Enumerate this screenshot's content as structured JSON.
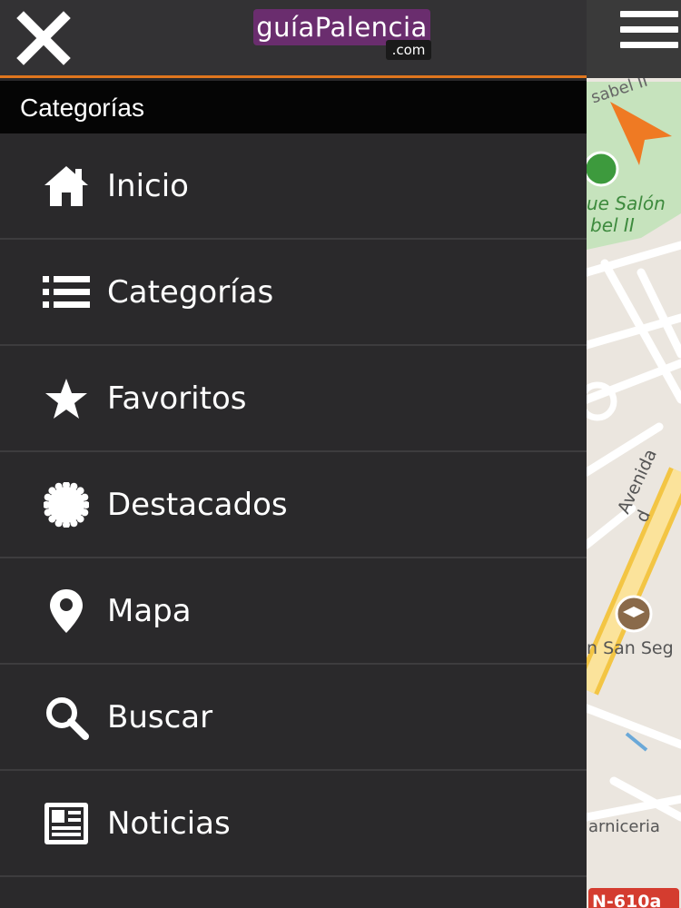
{
  "header": {
    "logo_main": "guíaPalencia",
    "logo_suffix": ".com"
  },
  "section_title": "Categorías",
  "menu": {
    "items": [
      {
        "label": "Inicio",
        "icon": "home-icon"
      },
      {
        "label": "Categorías",
        "icon": "list-icon"
      },
      {
        "label": "Favoritos",
        "icon": "star-icon"
      },
      {
        "label": "Destacados",
        "icon": "badge-icon"
      },
      {
        "label": "Mapa",
        "icon": "map-pin-icon"
      },
      {
        "label": "Buscar",
        "icon": "search-icon"
      },
      {
        "label": "Noticias",
        "icon": "newspaper-icon"
      }
    ]
  },
  "map": {
    "labels": [
      "sabel II",
      "ue Salón",
      "bel II",
      "Avenida d",
      "n San Seg",
      "arniceria",
      "N-610a"
    ]
  },
  "colors": {
    "accent": "#e0761e",
    "brand": "#6a2d6e",
    "drawer_bg": "#2a292b"
  }
}
